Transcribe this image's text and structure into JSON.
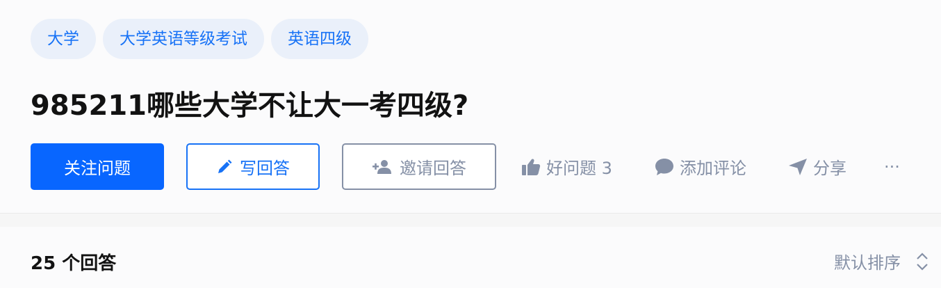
{
  "topics": [
    "大学",
    "大学英语等级考试",
    "英语四级"
  ],
  "question": {
    "title": "985211哪些大学不让大一考四级?"
  },
  "actions": {
    "follow_label": "关注问题",
    "write_label": "写回答",
    "invite_label": "邀请回答",
    "like_label": "好问题 3",
    "comment_label": "添加评论",
    "share_label": "分享",
    "more_label": "···"
  },
  "answers": {
    "count_label": "25 个回答",
    "sort_label": "默认排序"
  },
  "colors": {
    "accent": "#1772f6",
    "primary_button": "#0866ff",
    "tag_background": "#eaf0fa",
    "muted": "#8590a6"
  },
  "icons": {
    "write": "pencil-icon",
    "invite": "add-person-icon",
    "like": "thumbs-up-icon",
    "comment": "comment-bubble-icon",
    "share": "paper-plane-icon",
    "sort": "sort-updown-icon"
  }
}
